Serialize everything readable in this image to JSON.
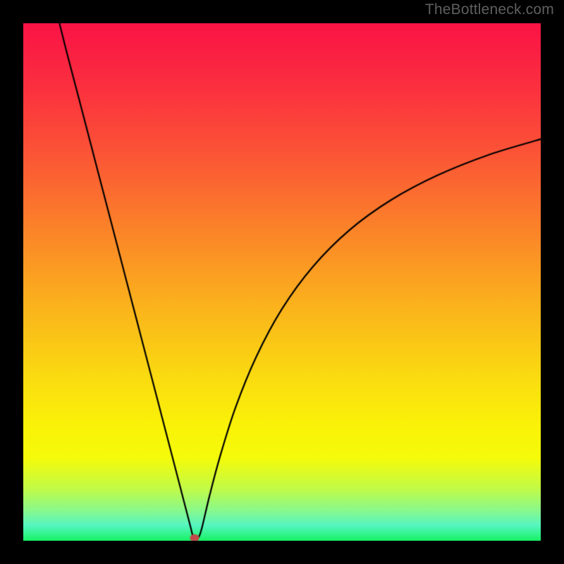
{
  "watermark": "TheBottleneck.com",
  "chart_data": {
    "type": "line",
    "title": "",
    "xlabel": "",
    "ylabel": "",
    "xlim": [
      0,
      100
    ],
    "ylim": [
      0,
      100
    ],
    "grid": false,
    "legend": false,
    "background_gradient": {
      "stops": [
        {
          "t": 0.0,
          "color": "#fa1346"
        },
        {
          "t": 0.12,
          "color": "#fb2f3f"
        },
        {
          "t": 0.25,
          "color": "#fb5436"
        },
        {
          "t": 0.4,
          "color": "#fb8429"
        },
        {
          "t": 0.55,
          "color": "#fbb41c"
        },
        {
          "t": 0.7,
          "color": "#fae00f"
        },
        {
          "t": 0.78,
          "color": "#faf308"
        },
        {
          "t": 0.84,
          "color": "#f5fb0a"
        },
        {
          "t": 0.9,
          "color": "#c1fb48"
        },
        {
          "t": 0.94,
          "color": "#8bf989"
        },
        {
          "t": 0.97,
          "color": "#56f6c1"
        },
        {
          "t": 1.0,
          "color": "#17f264"
        }
      ]
    },
    "series": [
      {
        "name": "bottleneck-curve",
        "color": "#000000",
        "x_optimum": 33,
        "points": [
          {
            "x": 7.0,
            "y": 100.0
          },
          {
            "x": 8.5,
            "y": 94.0
          },
          {
            "x": 11.0,
            "y": 84.5
          },
          {
            "x": 14.0,
            "y": 73.0
          },
          {
            "x": 17.0,
            "y": 61.5
          },
          {
            "x": 20.0,
            "y": 50.0
          },
          {
            "x": 23.0,
            "y": 38.5
          },
          {
            "x": 26.0,
            "y": 27.0
          },
          {
            "x": 29.0,
            "y": 15.5
          },
          {
            "x": 31.0,
            "y": 7.8
          },
          {
            "x": 32.3,
            "y": 2.8
          },
          {
            "x": 32.8,
            "y": 0.9
          },
          {
            "x": 33.4,
            "y": 0.55
          },
          {
            "x": 34.0,
            "y": 0.9
          },
          {
            "x": 34.6,
            "y": 2.8
          },
          {
            "x": 36.0,
            "y": 8.7
          },
          {
            "x": 38.0,
            "y": 16.2
          },
          {
            "x": 41.0,
            "y": 25.7
          },
          {
            "x": 45.0,
            "y": 35.5
          },
          {
            "x": 50.0,
            "y": 44.8
          },
          {
            "x": 56.0,
            "y": 53.0
          },
          {
            "x": 63.0,
            "y": 60.0
          },
          {
            "x": 71.0,
            "y": 65.8
          },
          {
            "x": 80.0,
            "y": 70.6
          },
          {
            "x": 90.0,
            "y": 74.6
          },
          {
            "x": 100.0,
            "y": 77.6
          }
        ]
      }
    ],
    "annotations": [
      {
        "name": "optimum-marker",
        "kind": "ellipse",
        "cx": 33.1,
        "cy": 0.55,
        "rx": 0.9,
        "ry": 0.7,
        "fill": "#c24a4a"
      }
    ]
  }
}
